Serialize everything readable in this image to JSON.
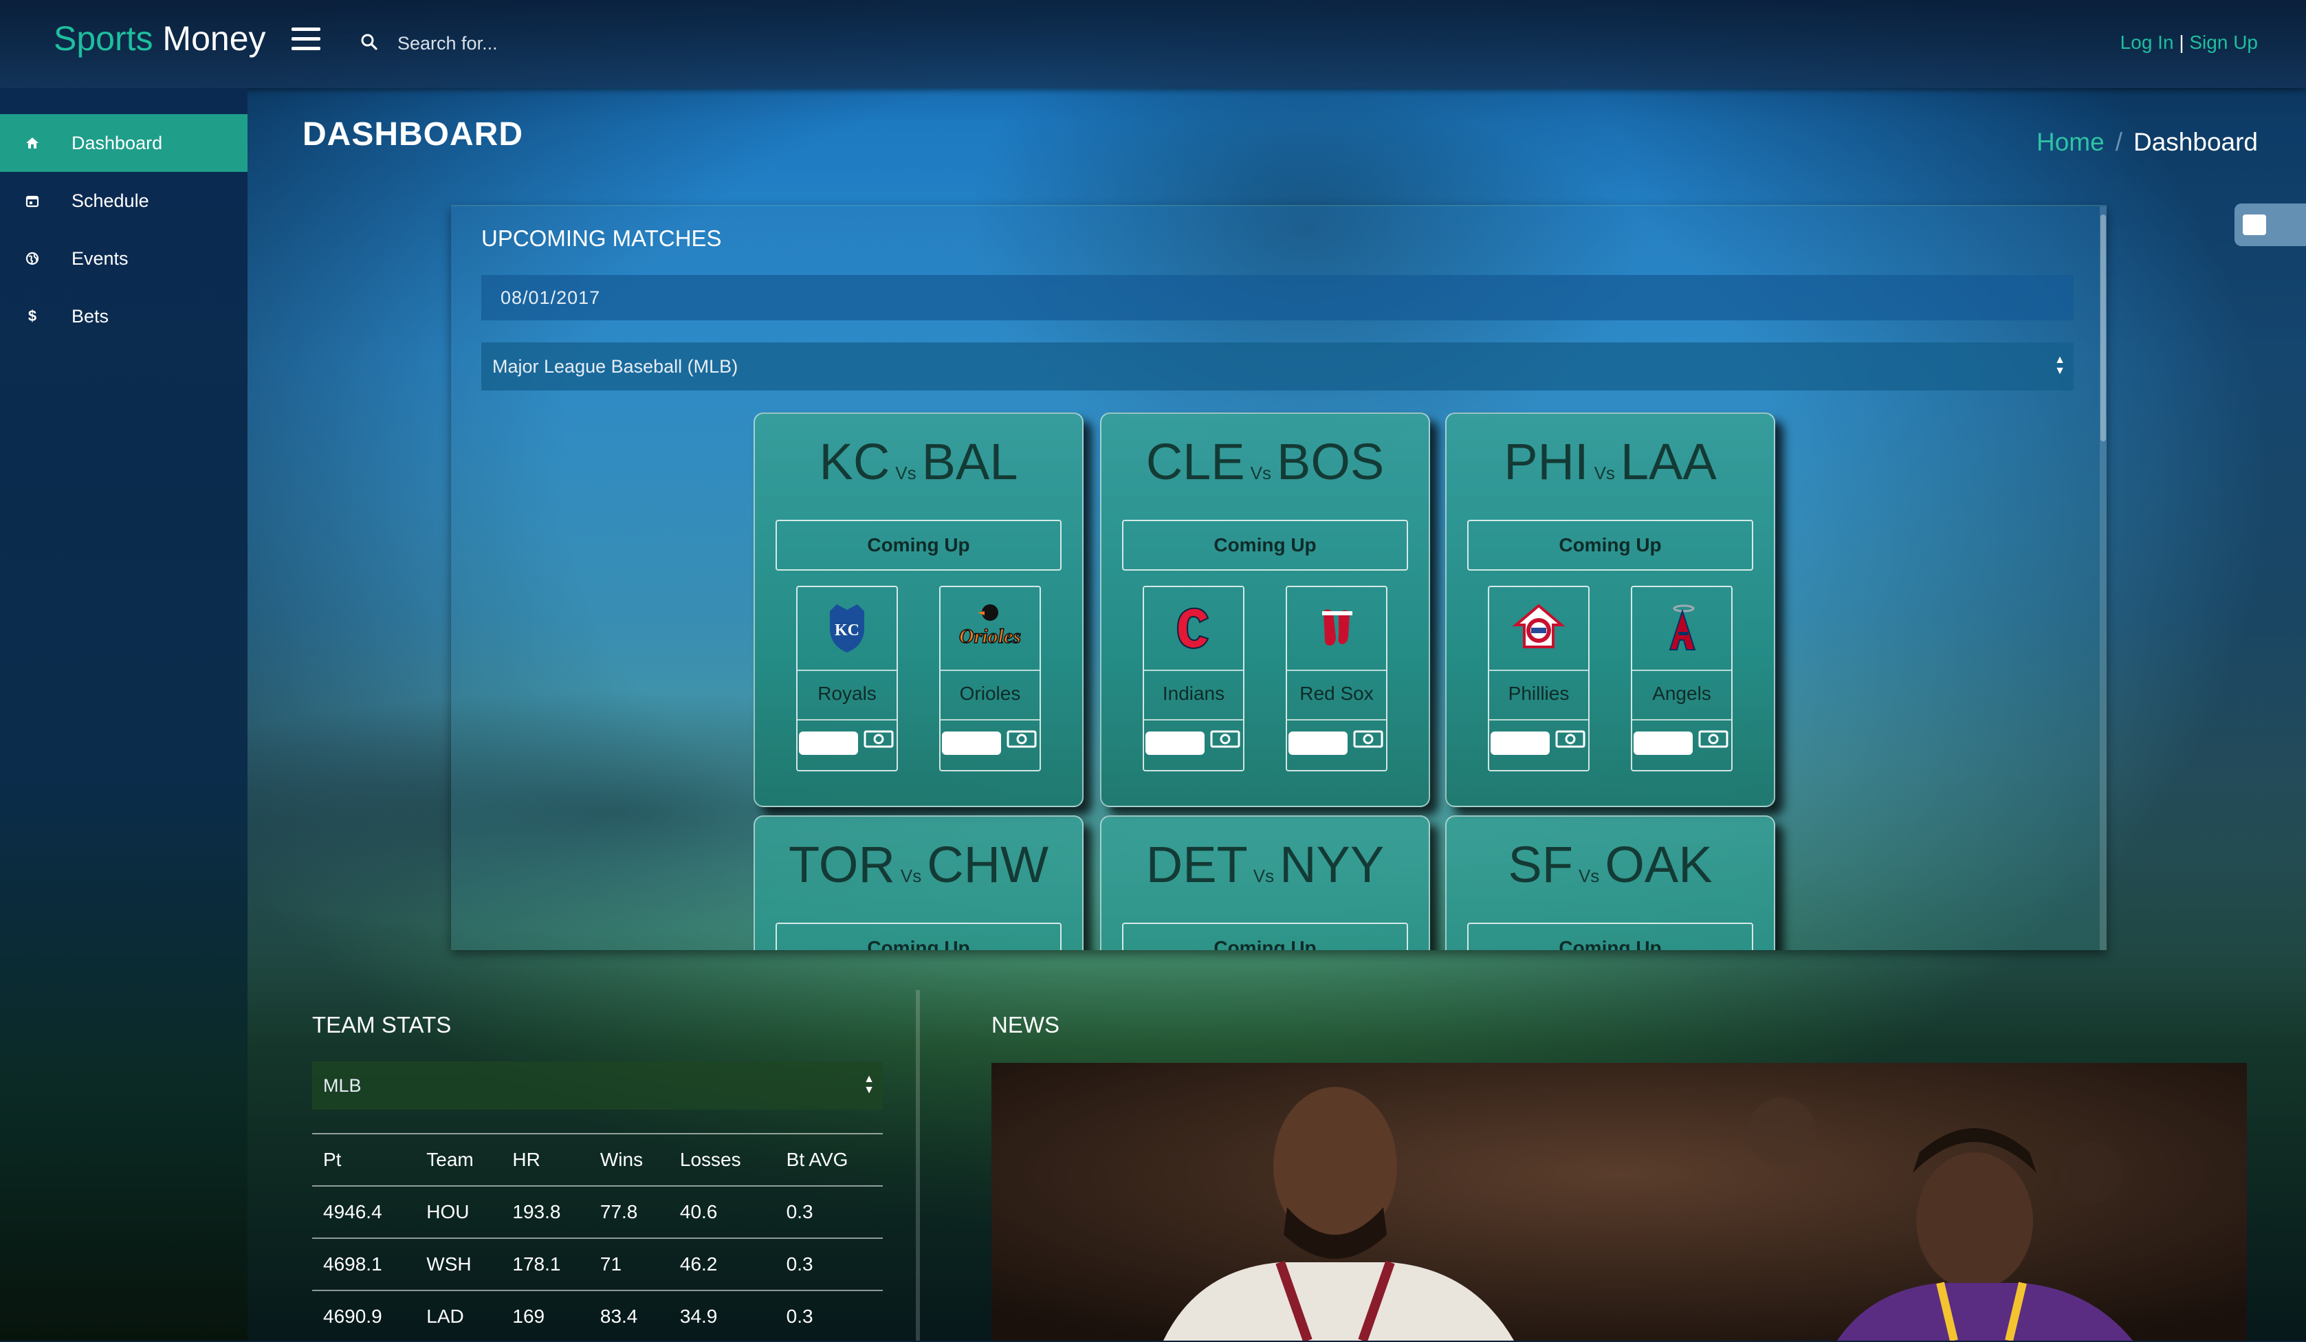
{
  "brand": {
    "light": "Sports",
    "strong": "Money"
  },
  "search": {
    "placeholder": "Search for..."
  },
  "auth": {
    "login": "Log In",
    "separator": "|",
    "signup": "Sign Up"
  },
  "sidebar": {
    "items": [
      {
        "label": "Dashboard",
        "icon": "home-icon",
        "active": true
      },
      {
        "label": "Schedule",
        "icon": "calendar-icon"
      },
      {
        "label": "Events",
        "icon": "globe-icon"
      },
      {
        "label": "Bets",
        "icon": "dollar-icon"
      }
    ]
  },
  "page": {
    "title": "DASHBOARD"
  },
  "breadcrumb": {
    "home": "Home",
    "separator": "/",
    "current": "Dashboard"
  },
  "upcoming": {
    "title": "UPCOMING MATCHES",
    "date": "08/01/2017",
    "league": "Major League Baseball (MLB)",
    "matches": [
      {
        "home": "KC",
        "away": "BAL",
        "vs": "Vs",
        "status": "Coming Up",
        "teams": [
          {
            "name": "Royals",
            "logo": "royals-logo"
          },
          {
            "name": "Orioles",
            "logo": "orioles-logo"
          }
        ]
      },
      {
        "home": "CLE",
        "away": "BOS",
        "vs": "Vs",
        "status": "Coming Up",
        "teams": [
          {
            "name": "Indians",
            "logo": "indians-logo"
          },
          {
            "name": "Red Sox",
            "logo": "redsox-logo"
          }
        ]
      },
      {
        "home": "PHI",
        "away": "LAA",
        "vs": "Vs",
        "status": "Coming Up",
        "teams": [
          {
            "name": "Phillies",
            "logo": "phillies-logo"
          },
          {
            "name": "Angels",
            "logo": "angels-logo"
          }
        ]
      },
      {
        "home": "TOR",
        "away": "CHW",
        "vs": "Vs",
        "status": "Coming Up"
      },
      {
        "home": "DET",
        "away": "NYY",
        "vs": "Vs",
        "status": "Coming Up"
      },
      {
        "home": "SF",
        "away": "OAK",
        "vs": "Vs",
        "status": "Coming Up"
      }
    ]
  },
  "team_stats": {
    "title": "TEAM STATS",
    "league": "MLB",
    "columns": [
      "Pt",
      "Team",
      "HR",
      "Wins",
      "Losses",
      "Bt AVG"
    ],
    "rows": [
      [
        "4946.4",
        "HOU",
        "193.8",
        "77.8",
        "40.6",
        "0.3"
      ],
      [
        "4698.1",
        "WSH",
        "178.1",
        "71",
        "46.2",
        "0.3"
      ],
      [
        "4690.9",
        "LAD",
        "169",
        "83.4",
        "34.9",
        "0.3"
      ]
    ]
  },
  "news": {
    "title": "NEWS"
  },
  "colors": {
    "accent": "#1fbf9e",
    "sidebar_active": "#1f9e8a",
    "card": "#2f9a8c"
  }
}
